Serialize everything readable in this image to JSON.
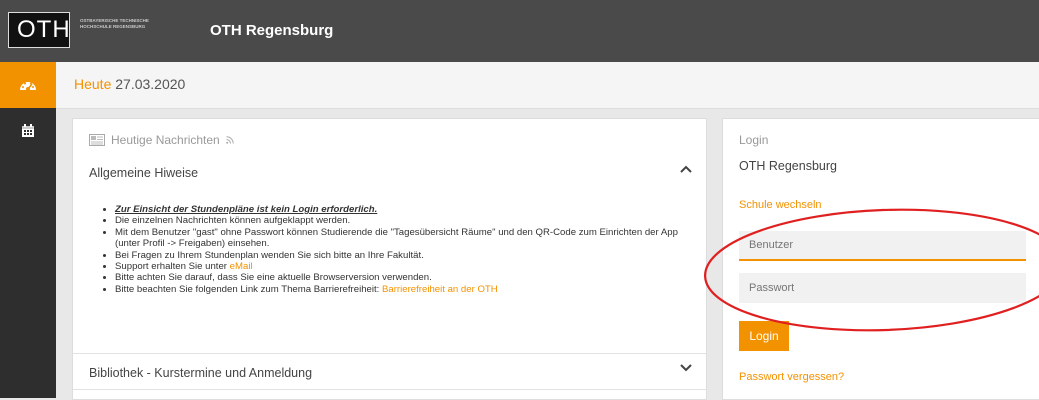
{
  "header": {
    "logo": "OTH",
    "logo_tagline": "Ostbayerische Technische Hochschule Regensburg",
    "title": "OTH Regensburg"
  },
  "sidebar": {
    "items": [
      {
        "icon": "dashboard-icon",
        "active": true
      },
      {
        "icon": "calendar-icon",
        "active": false
      }
    ]
  },
  "today": {
    "label": "Heute",
    "date": "27.03.2020"
  },
  "news": {
    "heading": "Heutige Nachrichten",
    "sections": [
      {
        "title": "Allgemeine Hiweise",
        "expanded": true,
        "items": [
          "Zur Einsicht der Stundenpläne ist kein Login erforderlich.",
          "Die einzelnen Nachrichten können aufgeklappt werden.",
          "Mit dem Benutzer \"gast\" ohne Passwort können Studierende die \"Tagesübersicht Räume\" und den QR-Code zum Einrichten der App (unter Profil -> Freigaben) einsehen.",
          "Bei Fragen zu Ihrem Stundenplan wenden Sie sich bitte an Ihre Fakultät.",
          "Support erhalten Sie unter ",
          "Bitte achten Sie darauf, dass Sie eine aktuelle Browserversion verwenden.",
          "Bitte beachten Sie folgenden Link zum Thema Barrierefreiheit: "
        ],
        "support_link": "eMail",
        "barrier_link": "Barrierefreiheit an der OTH"
      },
      {
        "title": "Bibliothek - Kurstermine und Anmeldung",
        "expanded": false
      }
    ]
  },
  "login": {
    "heading": "Login",
    "school": "OTH Regensburg",
    "switch_school": "Schule wechseln",
    "user_placeholder": "Benutzer",
    "password_placeholder": "Passwort",
    "button": "Login",
    "forgot": "Passwort vergessen?"
  },
  "colors": {
    "accent": "#f39200",
    "topbar": "#4a4a4a",
    "sidebar": "#2e2e2e",
    "annotation": "#e02020"
  }
}
